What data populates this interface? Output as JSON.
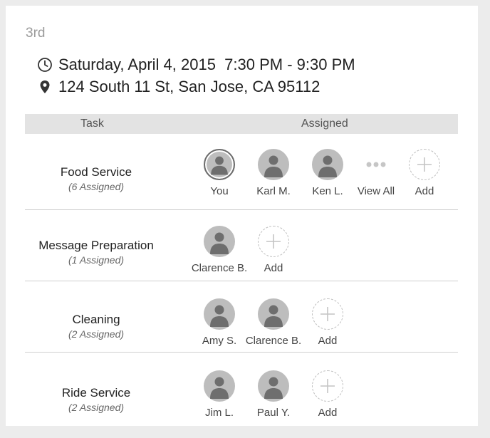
{
  "event": {
    "label": "3rd",
    "datetime": "Saturday, April 4, 2015  7:30 PM - 9:30 PM",
    "address": "124 South 11 St, San Jose, CA 95112"
  },
  "table": {
    "task_header": "Task",
    "assigned_header": "Assigned"
  },
  "tasks": [
    {
      "name": "Food Service",
      "count": "(6 Assigned)",
      "assignees": [
        "You",
        "Karl M.",
        "Ken L."
      ],
      "view_all": "View All",
      "add": "Add"
    },
    {
      "name": "Message Preparation",
      "count": "(1 Assigned)",
      "assignees": [
        "Clarence B."
      ],
      "add": "Add"
    },
    {
      "name": "Cleaning",
      "count": "(2 Assigned)",
      "assignees": [
        "Amy S.",
        "Clarence B."
      ],
      "add": "Add"
    },
    {
      "name": "Ride Service",
      "count": "(2 Assigned)",
      "assignees": [
        "Jim L.",
        "Paul Y."
      ],
      "add": "Add"
    }
  ],
  "icons": {
    "time": "clock-icon",
    "location": "map-pin-icon",
    "avatar": "user-avatar-icon",
    "add": "plus-icon",
    "more": "ellipsis-icon"
  },
  "colors": {
    "header_bg": "#e3e3e3",
    "avatar_bg": "#bdbdbd",
    "avatar_figure": "#6e6e6e"
  }
}
